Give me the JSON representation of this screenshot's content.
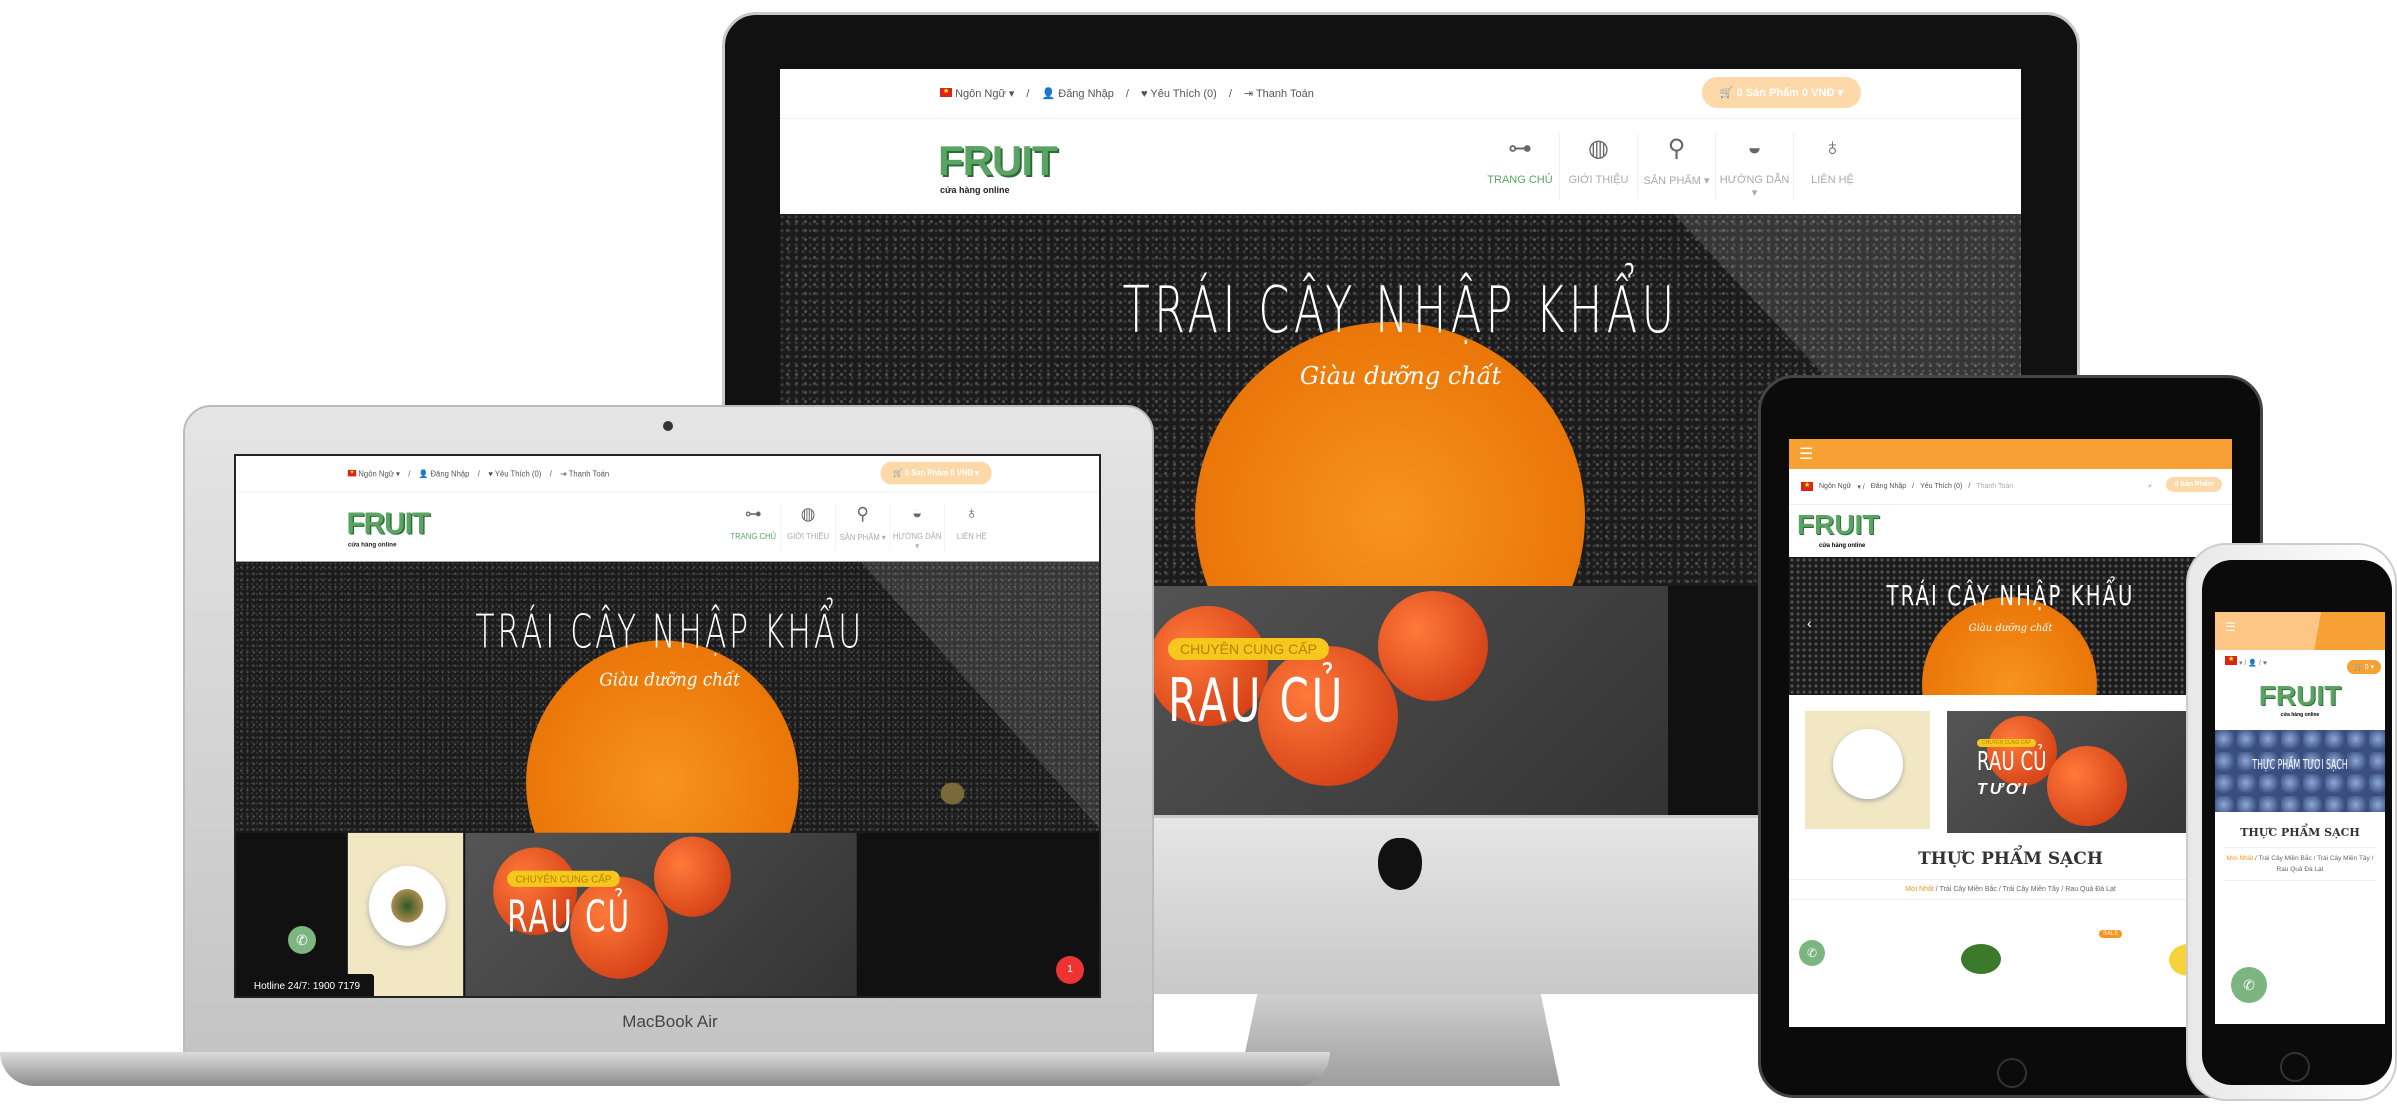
{
  "site": {
    "language": "Ngôn Ngữ",
    "login": "Đăng Nhập",
    "wishlist": "Yêu Thích (0)",
    "checkout": "Thanh Toán",
    "cart": "0 Sản Phẩm 0 VNĐ",
    "cart_short": "0 Sản Phẩm",
    "cart_mobile": "0",
    "logo": "FRUIT",
    "tagline": "cửa hàng online",
    "nav": [
      {
        "label": "TRANG CHỦ",
        "icon": "skewer-icon"
      },
      {
        "label": "GIỚI THIỆU",
        "icon": "steak-icon"
      },
      {
        "label": "SẢN PHẨM ▾",
        "icon": "drumstick-icon"
      },
      {
        "label": "HƯỚNG DẪN ▾",
        "icon": "taco-icon"
      },
      {
        "label": "LIÊN HỆ",
        "icon": "fruit-icon"
      }
    ],
    "hero_title": "TRÁI CÂY NHẬP KHẨU",
    "hero_subtitle": "Giàu dưỡng chất",
    "banner_tag": "CHUYÊN CUNG CẤP",
    "banner_title": "RAU CỦ",
    "banner_subtitle": "TƯƠI",
    "section_title": "THỰC PHẨM SẠCH",
    "tabs": [
      "Mới Nhất",
      "Trái Cây Miền Bắc",
      "Trái Cây Miền Tây",
      "Rau Quả Đà Lạt"
    ],
    "hotline": "Hotline 24/7: 1900 7179",
    "sale_badge": "SALE",
    "mobile_hero": "THỰC PHẨM TƯƠI SẠCH",
    "chat_badge": "1"
  },
  "devices": {
    "laptop_label": "MacBook Air"
  },
  "colors": {
    "brand_green": "#5aa463",
    "accent_orange": "#f7941d",
    "cart_peach": "#fdd8a8",
    "banner_cream": "#f1e7c3"
  }
}
